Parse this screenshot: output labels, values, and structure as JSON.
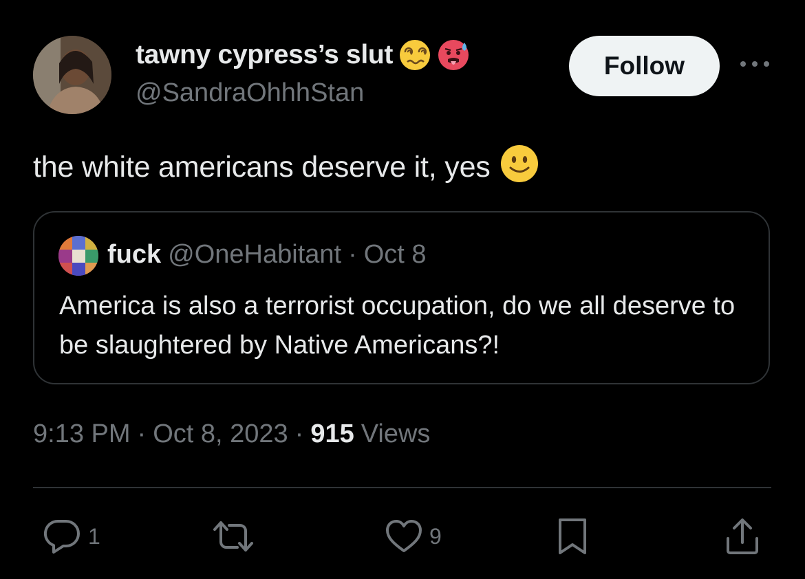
{
  "author": {
    "display_name": "tawny cypress’s slut",
    "handle": "@SandraOhhhStan",
    "emoji_icons": [
      "woozy-face-icon",
      "hot-face-icon"
    ]
  },
  "follow_label": "Follow",
  "tweet": {
    "text": "the white americans deserve it, yes",
    "emoji_icon": "slightly-smiling-face-icon"
  },
  "quoted": {
    "name": "fuck",
    "handle": "@OneHabitant",
    "separator": "·",
    "date": "Oct 8",
    "text": "America is also a terrorist occupation, do we all deserve to be slaughtered by Native Americans?!"
  },
  "meta": {
    "time": "9:13 PM",
    "separator1": "·",
    "date": "Oct 8, 2023",
    "separator2": "·",
    "views_count": "915",
    "views_label": "Views"
  },
  "actions": {
    "reply_count": "1",
    "like_count": "9"
  },
  "colors": {
    "background": "#000000",
    "text_primary": "#e7e9ea",
    "text_secondary": "#71767b",
    "border": "#2f3336",
    "follow_bg": "#eff3f4"
  }
}
